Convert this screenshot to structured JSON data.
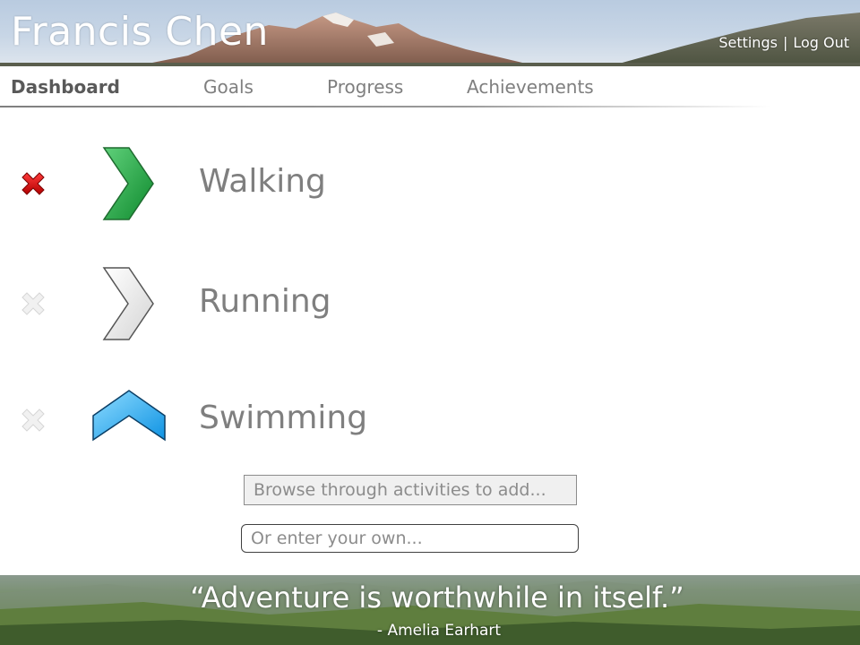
{
  "header": {
    "user_name": "Francis Chen",
    "links": {
      "settings": "Settings",
      "separator": "|",
      "logout": "Log Out"
    }
  },
  "nav": {
    "items": [
      {
        "label": "Dashboard",
        "active": true
      },
      {
        "label": "Goals",
        "active": false
      },
      {
        "label": "Progress",
        "active": false
      },
      {
        "label": "Achievements",
        "active": false
      }
    ]
  },
  "activities": [
    {
      "name": "Walking",
      "trend": "right",
      "trend_color": "#22aa44",
      "remove_active": true
    },
    {
      "name": "Running",
      "trend": "right",
      "trend_color": "#e0e0e0",
      "remove_active": false
    },
    {
      "name": "Swimming",
      "trend": "up",
      "trend_color": "#2aa6ea",
      "remove_active": false
    }
  ],
  "icons": {
    "remove": "close-icon",
    "trend_right": "chevron-right-icon",
    "trend_up": "chevron-up-icon"
  },
  "browse": {
    "label": "Browse through activities to add..."
  },
  "custom_input": {
    "placeholder": "Or enter your own..."
  },
  "footer": {
    "quote": "“Adventure is worthwhile in itself.”",
    "author": "- Amelia Earhart"
  }
}
